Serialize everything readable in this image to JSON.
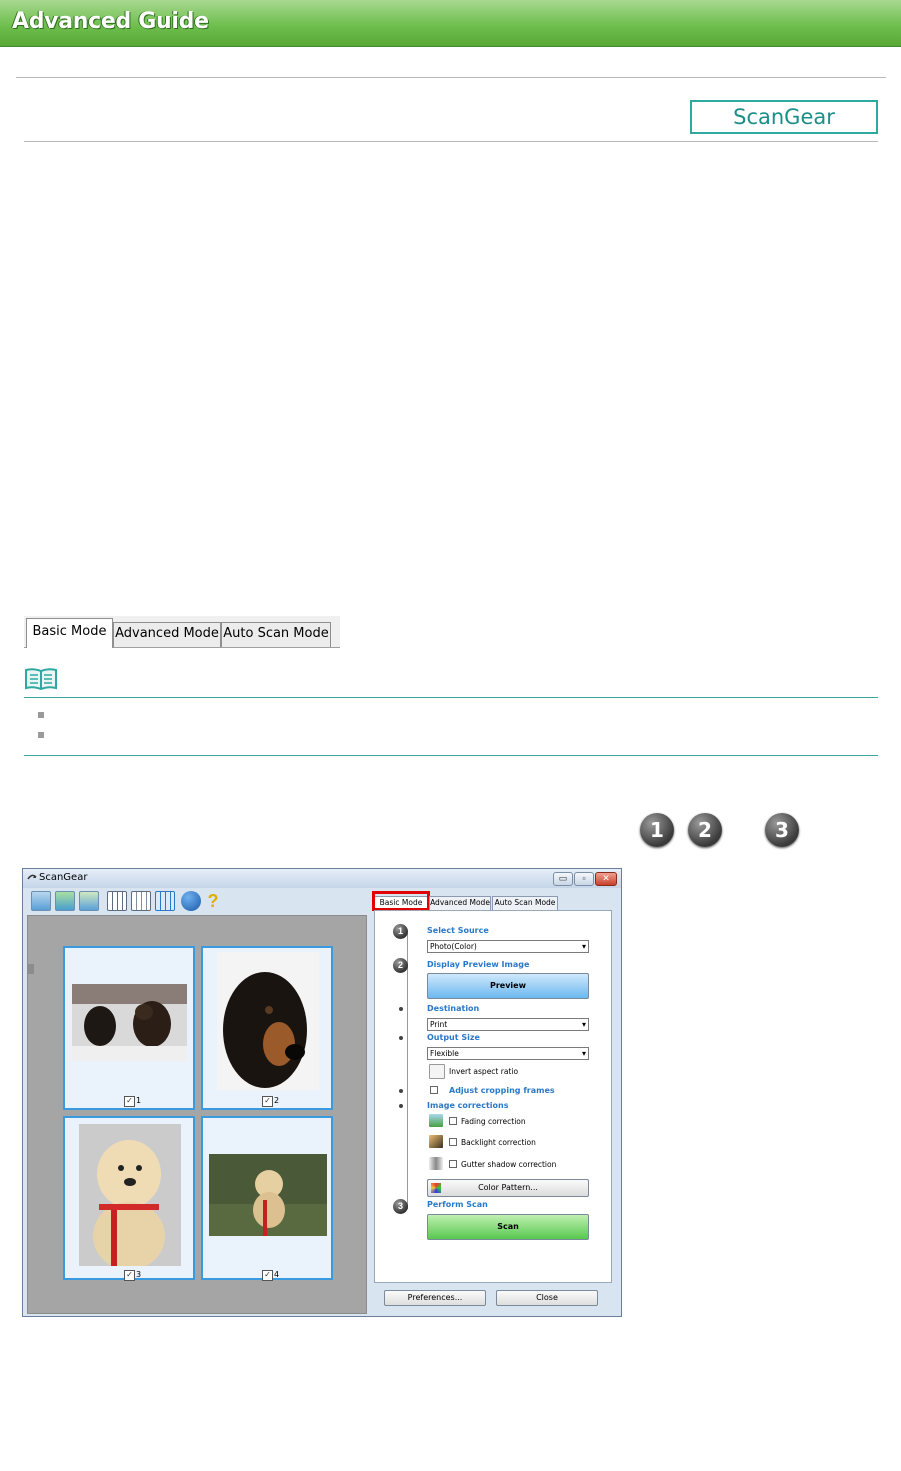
{
  "header": {
    "title": "Advanced Guide"
  },
  "badge": {
    "label": "ScanGear"
  },
  "mode_tabs": [
    {
      "label": "Basic Mode",
      "active": true
    },
    {
      "label": "Advanced Mode",
      "active": false
    },
    {
      "label": "Auto Scan Mode",
      "active": false
    }
  ],
  "steps": {
    "one": "1",
    "two": "2",
    "three": "3"
  },
  "window": {
    "title": "ScanGear",
    "controls": {
      "minimize": "▭",
      "maximize": "▫",
      "close": "✕"
    },
    "thumbnails": [
      {
        "index": "1",
        "checked": "✓"
      },
      {
        "index": "2",
        "checked": "✓"
      },
      {
        "index": "3",
        "checked": "✓"
      },
      {
        "index": "4",
        "checked": "✓"
      }
    ],
    "tabs": {
      "basic": "Basic Mode",
      "advanced": "Advanced Mode",
      "auto": "Auto Scan Mode"
    },
    "panel": {
      "select_source_label": "Select Source",
      "select_source_value": "Photo(Color)",
      "display_preview_label": "Display Preview Image",
      "preview_button": "Preview",
      "destination_label": "Destination",
      "destination_value": "Print",
      "output_size_label": "Output Size",
      "output_size_value": "Flexible",
      "invert_aspect": "Invert aspect ratio",
      "adjust_cropping": "Adjust cropping frames",
      "image_corrections_label": "Image corrections",
      "fading": "Fading correction",
      "backlight": "Backlight correction",
      "gutter": "Gutter shadow correction",
      "color_pattern_button": "Color Pattern...",
      "perform_scan_label": "Perform Scan",
      "scan_button": "Scan",
      "preferences_button": "Preferences...",
      "close_button": "Close"
    }
  },
  "colors": {
    "accent": "#2fa8a0",
    "banner": "#6fbf4f",
    "highlight": "#e00000",
    "link_blue": "#2a78c8"
  }
}
